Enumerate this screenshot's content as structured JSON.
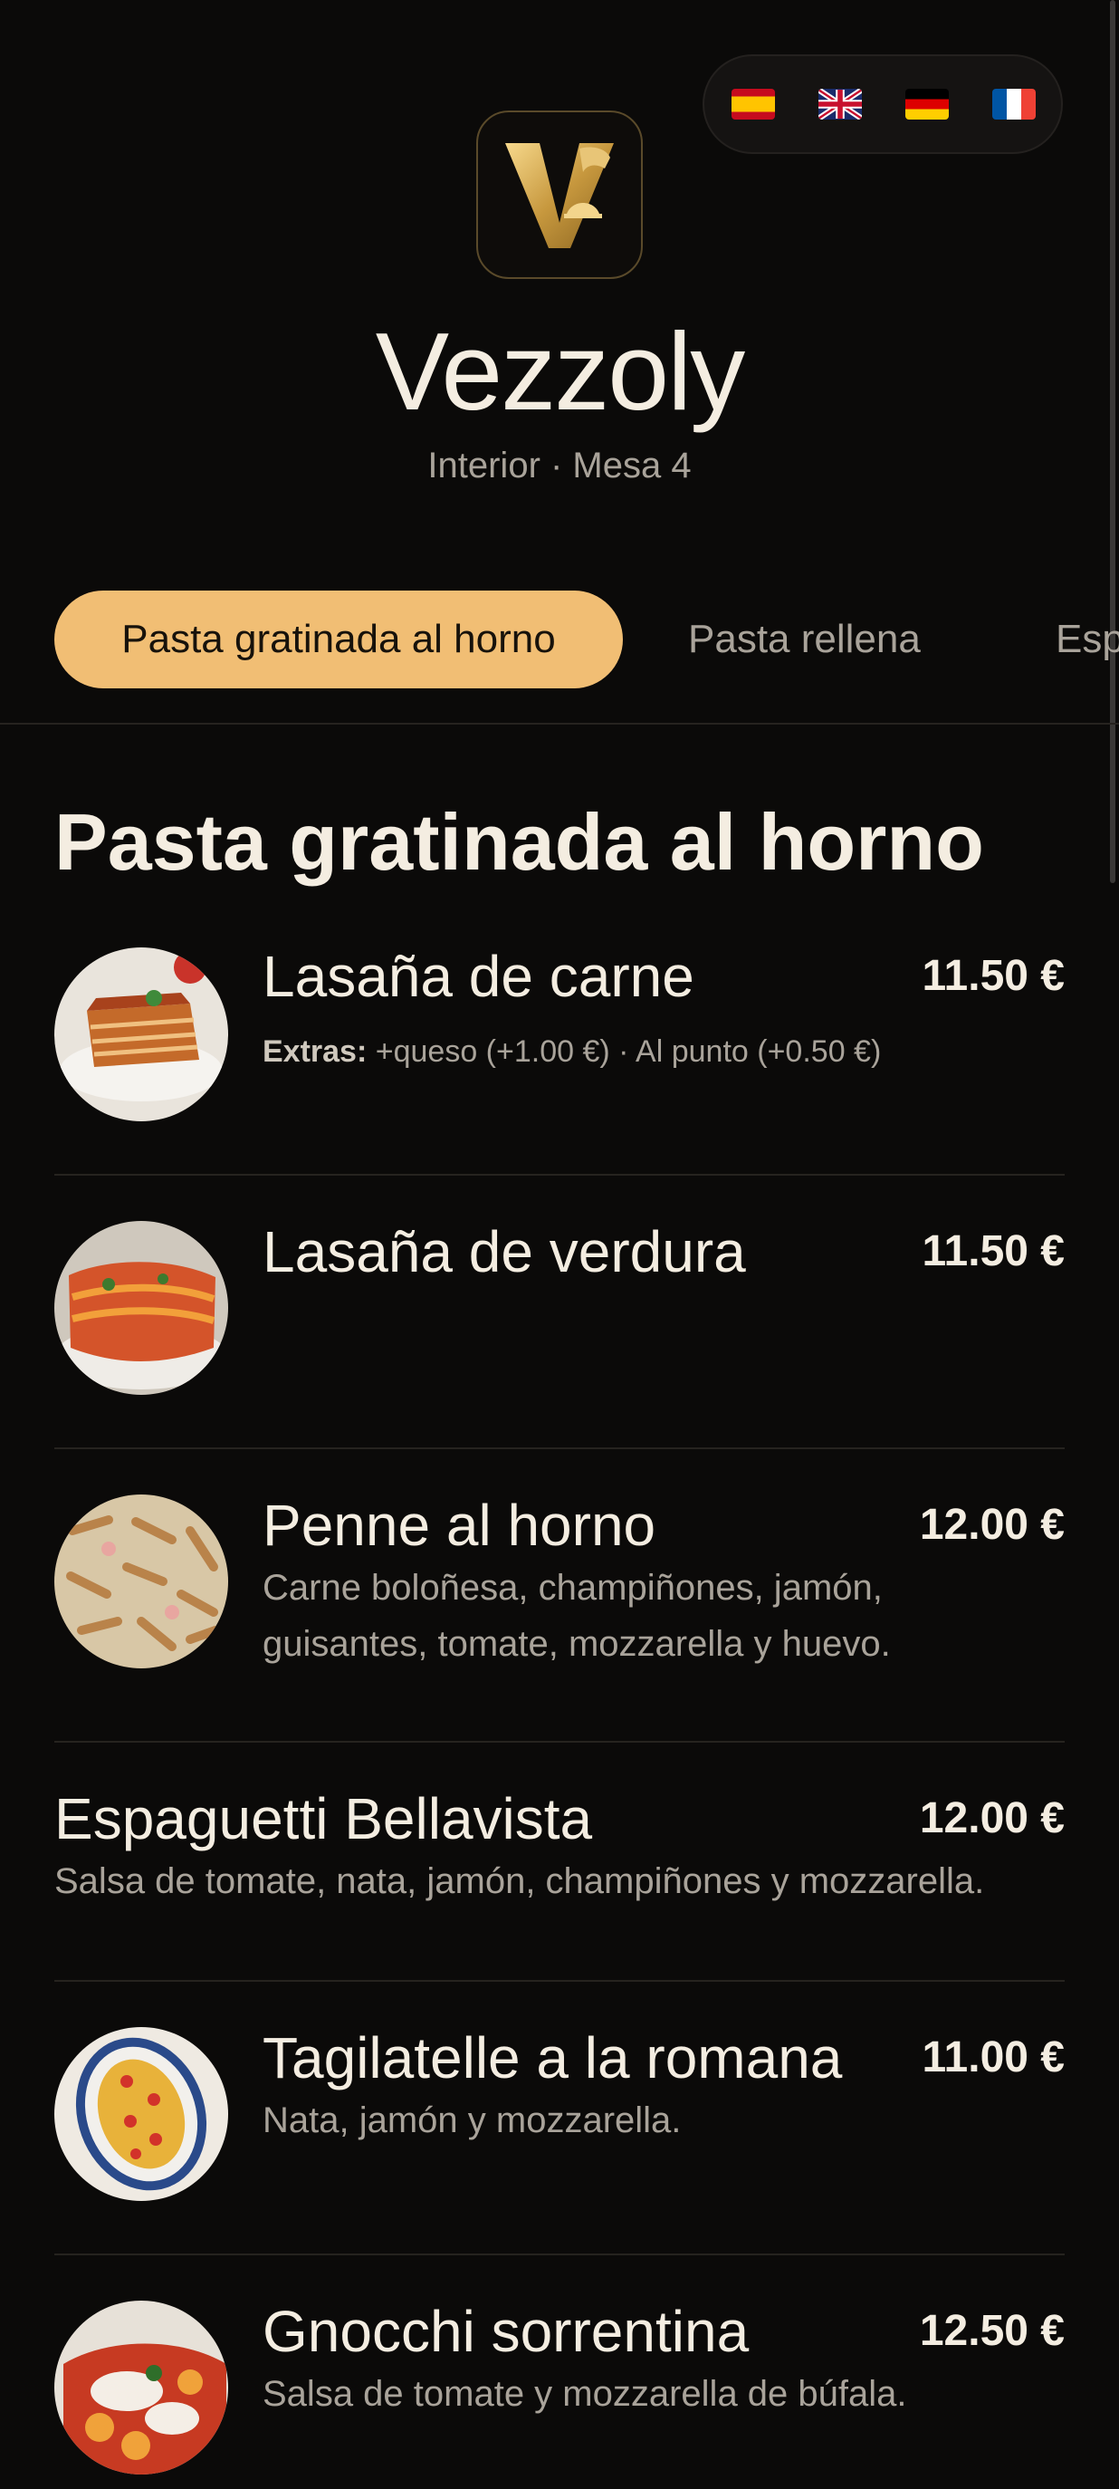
{
  "languages": [
    {
      "code": "es",
      "icon": "spain-flag-icon"
    },
    {
      "code": "en",
      "icon": "uk-flag-icon"
    },
    {
      "code": "de",
      "icon": "germany-flag-icon"
    },
    {
      "code": "fr",
      "icon": "france-flag-icon"
    }
  ],
  "header": {
    "brand": "Vezzoly",
    "subtitle": "Interior · Mesa 4",
    "logo_icon": "vezzoly-logo"
  },
  "categories": {
    "active": "Pasta gratinada al horno",
    "items": [
      "Pasta gratinada al horno",
      "Pasta rellena",
      "Esp"
    ]
  },
  "section": {
    "title": "Pasta gratinada al horno"
  },
  "dishes": [
    {
      "name": "Lasaña de carne",
      "price": "11.50 €",
      "extras_label": "Extras:",
      "extras": "+queso (+1.00 €) · Al punto (+0.50 €)",
      "image_icon": "lasagna-meat-photo"
    },
    {
      "name": "Lasaña de verdura",
      "price": "11.50 €",
      "image_icon": "lasagna-vegetable-photo"
    },
    {
      "name": "Penne al horno",
      "price": "12.00 €",
      "desc": "Carne boloñesa, champiñones, jamón, guisantes, tomate, mozzarella y huevo.",
      "image_icon": "penne-photo"
    },
    {
      "name": "Espaguetti Bellavista",
      "price": "12.00 €",
      "desc": "Salsa de tomate, nata, jamón, champiñones y mozzarella."
    },
    {
      "name": "Tagilatelle a la romana",
      "price": "11.00 €",
      "desc": "Nata, jamón y mozzarella.",
      "image_icon": "tagliatelle-photo"
    },
    {
      "name": "Gnocchi sorrentina",
      "price": "12.50 €",
      "desc": "Salsa de tomate y mozzarella de búfala.",
      "image_icon": "gnocchi-photo"
    }
  ],
  "colors": {
    "background": "#0b0a09",
    "accent": "#f1be74",
    "text": "#f4ede1",
    "muted": "#a9a39a"
  }
}
